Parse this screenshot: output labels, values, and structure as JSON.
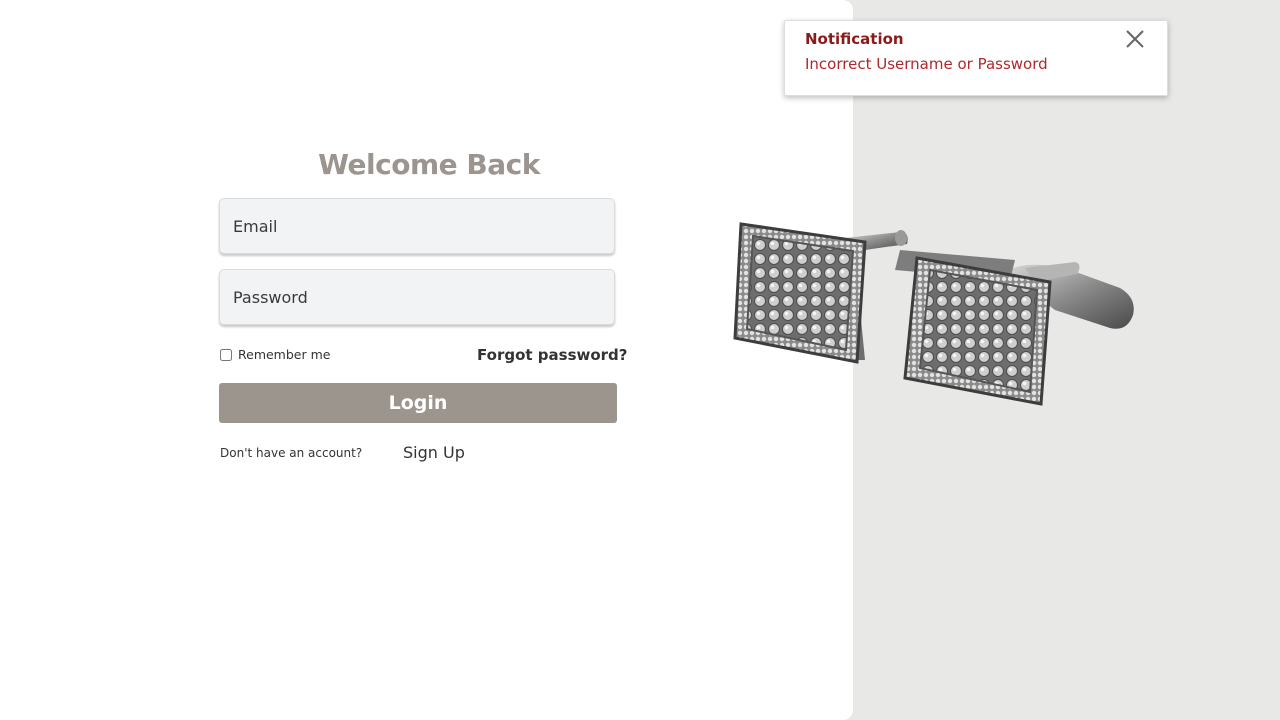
{
  "login": {
    "title": "Welcome Back",
    "email_placeholder": "Email",
    "password_placeholder": "Password",
    "remember_label": "Remember me",
    "forgot_label": "Forgot password?",
    "login_label": "Login",
    "no_account_text": "Don't have an account?",
    "signup_label": "Sign Up"
  },
  "notification": {
    "title": "Notification",
    "message": "Incorrect Username or Password",
    "close_icon": "close-icon"
  },
  "hero_image": {
    "icon": "cufflinks-image"
  },
  "colors": {
    "accent": "#9b958e",
    "right_panel_bg": "#e8e9e6",
    "error_title": "#8b1a1a",
    "error_text": "#b0282c"
  }
}
